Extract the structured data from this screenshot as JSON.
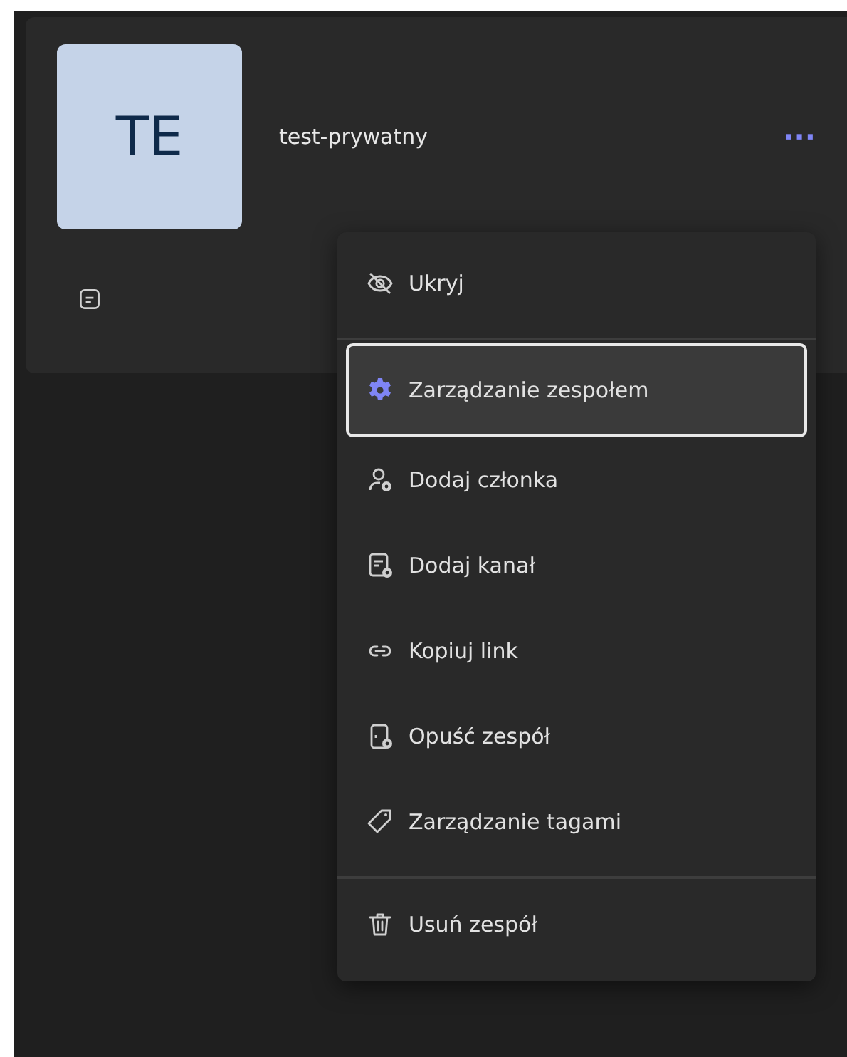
{
  "team": {
    "initials": "TE",
    "name": "test-prywatny",
    "more": "···"
  },
  "menu": {
    "sections": [
      [
        {
          "label": "Ukryj",
          "selected": false
        }
      ],
      [
        {
          "label": "Zarządzanie zespołem",
          "selected": true
        },
        {
          "label": "Dodaj członka",
          "selected": false
        },
        {
          "label": "Dodaj kanał",
          "selected": false
        },
        {
          "label": "Kopiuj link",
          "selected": false
        },
        {
          "label": "Opuść zespół",
          "selected": false
        },
        {
          "label": "Zarządzanie tagami",
          "selected": false
        }
      ],
      [
        {
          "label": "Usuń zespół",
          "selected": false
        }
      ]
    ]
  }
}
